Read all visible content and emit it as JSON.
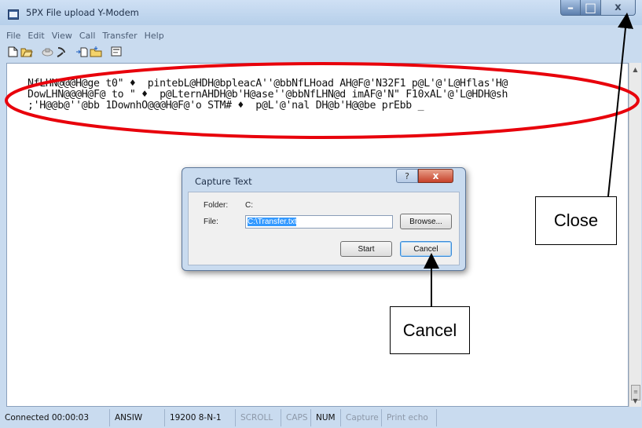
{
  "window": {
    "title": "5PX File upload Y-Modem",
    "buttons": {
      "minimize": "–",
      "maximize": "□",
      "close": "x"
    }
  },
  "menu": [
    "File",
    "Edit",
    "View",
    "Call",
    "Transfer",
    "Help"
  ],
  "toolbar": [
    "new-icon",
    "open-icon",
    "disconnect-icon",
    "connect-icon",
    "send-icon",
    "receive-icon",
    "properties-icon"
  ],
  "terminal": {
    "lines": [
      "NfLHN@@@H@ge t0\" ♦  pintebL@HDH@bpleacA''@bbNfLHoad AH@F@'N32F1 p@L'@'L@Hflas'H@",
      "DowLHN@@@H@F@ to \" ♦  p@LternAHDH@b'H@ase''@bbNfLHN@d imAF@'N\" F10xAL'@'L@HDH@sh",
      ";'H@@b@''@bb 1DownhO@@@H@F@'o STM# ♦  p@L'@'nal DH@b'H@@be prEbb _"
    ]
  },
  "dialog": {
    "title": "Capture Text",
    "help_label": "?",
    "close_label": "x",
    "folder_label": "Folder:",
    "folder_value": "C:",
    "file_label": "File:",
    "file_value": "C:\\Transfer.txt",
    "browse_label": "Browse...",
    "start_label": "Start",
    "cancel_label": "Cancel"
  },
  "statusbar": {
    "connected": "Connected 00:00:03",
    "emulation": "ANSIW",
    "settings": "19200 8-N-1",
    "scroll": "SCROLL",
    "caps": "CAPS",
    "num": "NUM",
    "capture": "Capture",
    "print_echo": "Print echo"
  },
  "annotations": {
    "close_label": "Close",
    "cancel_label": "Cancel",
    "highlight_color": "#e8000b"
  }
}
